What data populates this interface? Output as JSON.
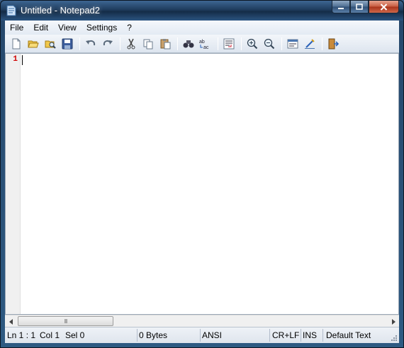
{
  "window": {
    "title": "Untitled - Notepad2"
  },
  "menu": [
    "File",
    "Edit",
    "View",
    "Settings",
    "?"
  ],
  "toolbar": {
    "icons": [
      "new-icon",
      "open-icon",
      "browse-icon",
      "save-icon",
      "undo-icon",
      "redo-icon",
      "cut-icon",
      "copy-icon",
      "paste-icon",
      "find-icon",
      "replace-icon",
      "word-wrap-icon",
      "zoom-in-icon",
      "zoom-out-icon",
      "scheme-icon",
      "customize-icon",
      "exit-icon"
    ]
  },
  "editor": {
    "line_number": "1",
    "content": ""
  },
  "scrollbar": {
    "grip": "III"
  },
  "status": {
    "position": "Ln 1 : 1",
    "column": "Col 1",
    "selection": "Sel 0",
    "size": "0 Bytes",
    "encoding": "ANSI",
    "line_ending": "CR+LF",
    "mode": "INS",
    "scheme": "Default Text"
  },
  "colors": {
    "title_bar": "#1f3c5e",
    "line_number": "#d00000",
    "close_button": "#c75a3e"
  }
}
